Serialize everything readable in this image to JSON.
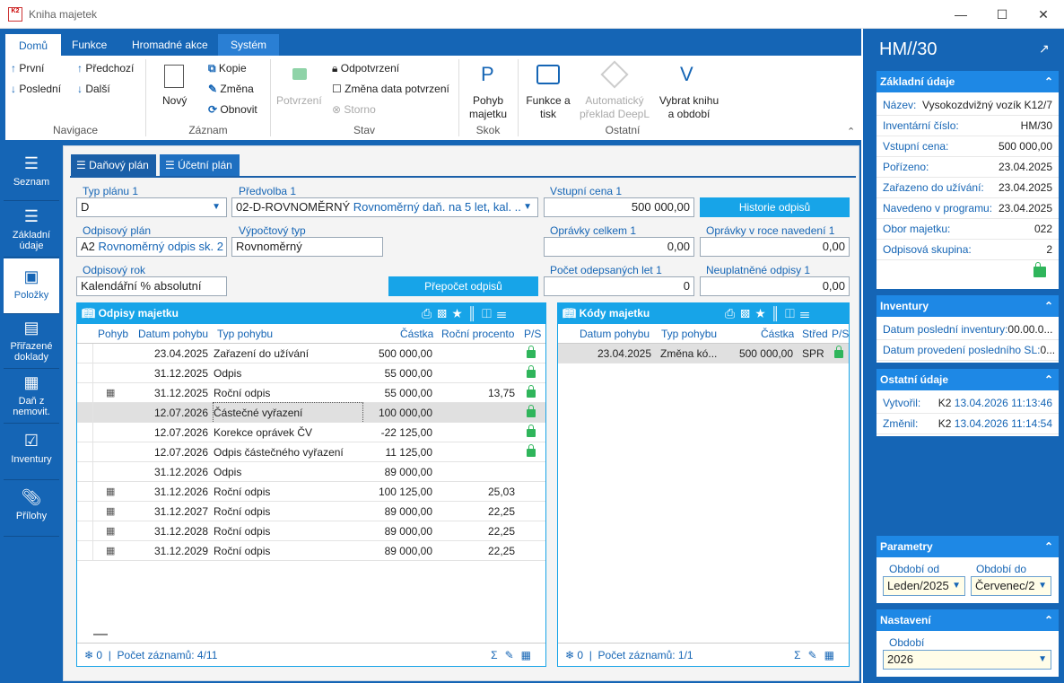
{
  "window": {
    "title": "Kniha majetek",
    "logo_text": "K2"
  },
  "ribbon": {
    "tabs": [
      "Domů",
      "Funkce",
      "Hromadné akce",
      "Systém"
    ],
    "navigace": {
      "prvni": "První",
      "posledni": "Poslední",
      "predchozi": "Předchozí",
      "dalsi": "Další",
      "group": "Navigace"
    },
    "zaznam": {
      "novy": "Nový",
      "kopie": "Kopie",
      "zmena": "Změna",
      "obnovit": "Obnovit",
      "group": "Záznam"
    },
    "stav": {
      "potvrzeni": "Potvrzení",
      "odpotvrzeni": "Odpotvrzení",
      "zmena_data": "Změna data potvrzení",
      "storno": "Storno",
      "group": "Stav"
    },
    "skok": {
      "pohyb_l1": "Pohyb",
      "pohyb_l2": "majetku",
      "group": "Skok"
    },
    "ostatni": {
      "funkce_l1": "Funkce a",
      "funkce_l2": "tisk",
      "deepl_l1": "Automatický",
      "deepl_l2": "překlad DeepL",
      "vybrat_l1": "Vybrat knihu",
      "vybrat_l2": "a období",
      "group": "Ostatní"
    }
  },
  "sidenav": [
    {
      "label": "Seznam"
    },
    {
      "label": "Základní údaje"
    },
    {
      "label": "Položky"
    },
    {
      "label": "Přiřazené doklady"
    },
    {
      "label": "Daň z nemovit."
    },
    {
      "label": "Inventury"
    },
    {
      "label": "Přílohy"
    }
  ],
  "plan_tabs": [
    "Daňový plán",
    "Účetní plán"
  ],
  "form": {
    "typ_planu_label": "Typ plánu 1",
    "typ_planu": "D",
    "predvolba_label": "Předvolba 1",
    "predvolba_code": "02-D-ROVNOMĚRNÝ",
    "predvolba_text": "Rovnoměrný daň. na 5 let, kal. ...",
    "vstupni_cena_label": "Vstupní cena 1",
    "vstupni_cena": "500 000,00",
    "historie_btn": "Historie odpisů",
    "odpisovy_plan_label": "Odpisový plán",
    "odpisovy_plan_code": "A2",
    "odpisovy_plan_text": "Rovnoměrný odpis sk. 2",
    "vypoctovy_typ_label": "Výpočtový typ",
    "vypoctovy_typ": "Rovnoměrný",
    "opravky_celkem_label": "Oprávky celkem 1",
    "opravky_celkem": "0,00",
    "opravky_roce_label": "Oprávky v roce navedení 1",
    "opravky_roce": "0,00",
    "odpisovy_rok_label": "Odpisový rok",
    "odpisovy_rok": "Kalendářní % absolutní",
    "prepocet_btn": "Přepočet odpisů",
    "pocet_let_label": "Počet odepsaných let 1",
    "pocet_let": "0",
    "neuplatnene_label": "Neuplatněné odpisy 1",
    "neuplatnene": "0,00"
  },
  "odpisy": {
    "title": "Odpisy majetku",
    "columns": [
      "Pohyb",
      "Datum pohybu",
      "Typ pohybu",
      "Částka",
      "Roční procento",
      "P/S"
    ],
    "rows": [
      {
        "cal": false,
        "date": "23.04.2025",
        "type": "Zařazení do užívání",
        "amount": "500 000,00",
        "pct": "",
        "lock": true
      },
      {
        "cal": false,
        "date": "31.12.2025",
        "type": "Odpis",
        "amount": "55 000,00",
        "pct": "",
        "lock": true
      },
      {
        "cal": true,
        "date": "31.12.2025",
        "type": "Roční odpis",
        "amount": "55 000,00",
        "pct": "13,75",
        "lock": true
      },
      {
        "cal": false,
        "date": "12.07.2026",
        "type": "Částečné vyřazení",
        "amount": "100 000,00",
        "pct": "",
        "lock": true
      },
      {
        "cal": false,
        "date": "12.07.2026",
        "type": "Korekce oprávek ČV",
        "amount": "-22 125,00",
        "pct": "",
        "lock": true
      },
      {
        "cal": false,
        "date": "12.07.2026",
        "type": "Odpis částečného vyřazení",
        "amount": "11 125,00",
        "pct": "",
        "lock": true
      },
      {
        "cal": false,
        "date": "31.12.2026",
        "type": "Odpis",
        "amount": "89 000,00",
        "pct": "",
        "lock": false
      },
      {
        "cal": true,
        "date": "31.12.2026",
        "type": "Roční odpis",
        "amount": "100 125,00",
        "pct": "25,03",
        "lock": false
      },
      {
        "cal": true,
        "date": "31.12.2027",
        "type": "Roční odpis",
        "amount": "89 000,00",
        "pct": "22,25",
        "lock": false
      },
      {
        "cal": true,
        "date": "31.12.2028",
        "type": "Roční odpis",
        "amount": "89 000,00",
        "pct": "22,25",
        "lock": false
      },
      {
        "cal": true,
        "date": "31.12.2029",
        "type": "Roční odpis",
        "amount": "89 000,00",
        "pct": "22,25",
        "lock": false
      }
    ],
    "footer_count": "0",
    "footer_records": "Počet záznamů: 4/11"
  },
  "kody": {
    "title": "Kódy majetku",
    "columns": [
      "Datum pohybu",
      "Typ pohybu",
      "Částka",
      "Střed",
      "P/S"
    ],
    "rows": [
      {
        "date": "23.04.2025",
        "type": "Změna kó...",
        "amount": "500 000,00",
        "stred": "SPR",
        "lock": true
      }
    ],
    "footer_count": "0",
    "footer_records": "Počet záznamů: 1/1"
  },
  "right": {
    "title": "HM//30",
    "zakladni": {
      "header": "Základní údaje",
      "rows": [
        {
          "k": "Název:",
          "v": "Vysokozdvižný vozík K12/7"
        },
        {
          "k": "Inventární číslo:",
          "v": "HM/30"
        },
        {
          "k": "Vstupní cena:",
          "v": "500 000,00"
        },
        {
          "k": "Pořízeno:",
          "v": "23.04.2025"
        },
        {
          "k": "Zařazeno do užívání:",
          "v": "23.04.2025"
        },
        {
          "k": "Navedeno v programu:",
          "v": "23.04.2025"
        },
        {
          "k": "Obor majetku:",
          "v": "022"
        },
        {
          "k": "Odpisová skupina:",
          "v": "2"
        }
      ]
    },
    "inventury": {
      "header": "Inventury",
      "rows": [
        {
          "k": "Datum poslední inventury:",
          "v": "00.00.0..."
        },
        {
          "k": "Datum provedení posledního SL:",
          "v": "0..."
        }
      ]
    },
    "ostatni": {
      "header": "Ostatní údaje",
      "vytvoril_k": "Vytvořil:",
      "vytvoril_user": "K2",
      "vytvoril_date": "13.04.2026 11:13:46",
      "zmenil_k": "Změnil:",
      "zmenil_user": "K2",
      "zmenil_date": "13.04.2026 11:14:54"
    },
    "parametry": {
      "header": "Parametry",
      "od_label": "Období od",
      "od": "Leden/2025",
      "do_label": "Období do",
      "do": "Červenec/2"
    },
    "nastaveni": {
      "header": "Nastavení",
      "obdobi_label": "Období",
      "obdobi": "2026"
    }
  }
}
